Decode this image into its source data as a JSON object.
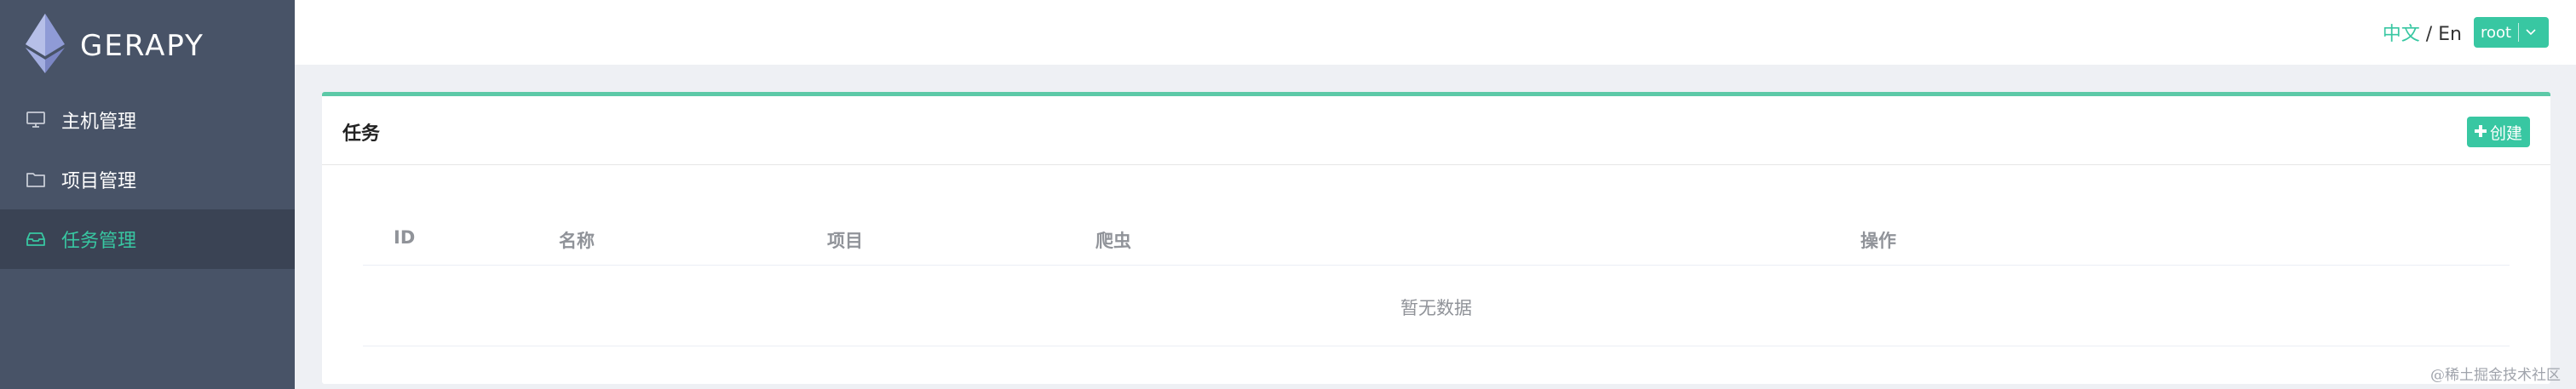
{
  "app": {
    "logo_text": "GERAPY"
  },
  "sidebar": {
    "items": [
      {
        "label": "主机管理",
        "icon": "monitor-icon",
        "active": false
      },
      {
        "label": "项目管理",
        "icon": "folder-icon",
        "active": false
      },
      {
        "label": "任务管理",
        "icon": "inbox-icon",
        "active": true
      }
    ]
  },
  "header": {
    "lang_zh": "中文",
    "lang_sep": " / ",
    "lang_en": "En",
    "user": "root"
  },
  "panel": {
    "title": "任务",
    "create_label": "创建"
  },
  "table": {
    "columns": [
      "ID",
      "名称",
      "项目",
      "爬虫",
      "操作"
    ],
    "empty_text": "暂无数据"
  },
  "watermark": "@稀土掘金技术社区",
  "colors": {
    "sidebar_bg": "#485367",
    "accent": "#38c7a2",
    "panel_top_border": "#5cc9a7"
  }
}
